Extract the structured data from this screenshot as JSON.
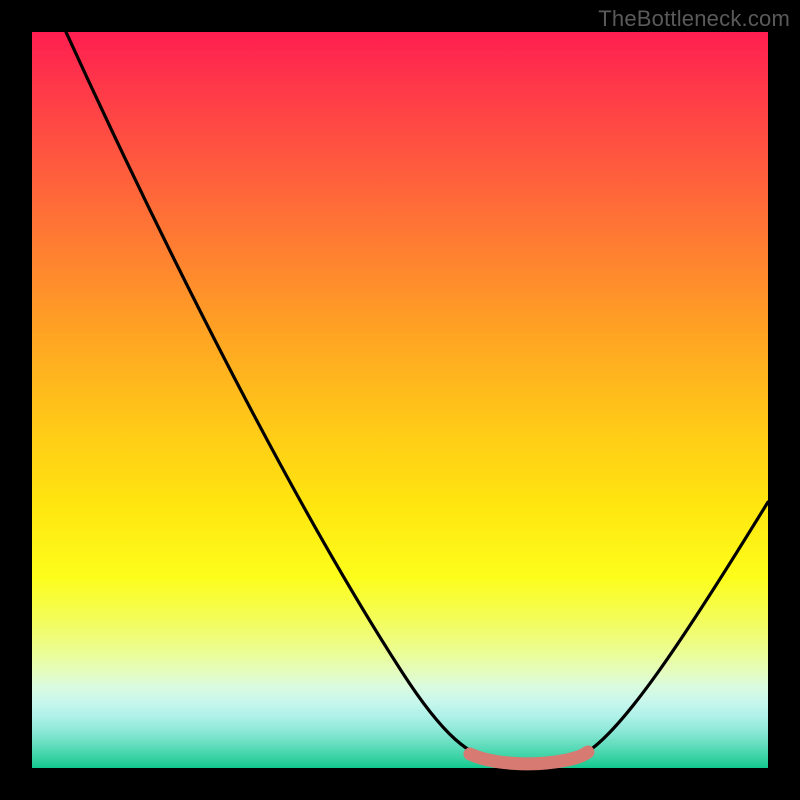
{
  "watermark": "TheBottleneck.com",
  "colors": {
    "black": "#000000",
    "curve": "#000000",
    "trough_highlight": "#d77a72"
  },
  "chart_data": {
    "type": "line",
    "title": "",
    "xlabel": "",
    "ylabel": "",
    "xlim": [
      0,
      100
    ],
    "ylim": [
      0,
      100
    ],
    "x": [
      0,
      5,
      10,
      15,
      20,
      25,
      30,
      35,
      40,
      45,
      50,
      55,
      60,
      62,
      64,
      66,
      68,
      70,
      72,
      74,
      78,
      82,
      86,
      90,
      94,
      98,
      100
    ],
    "values": [
      100,
      91,
      82,
      73,
      64,
      55,
      46,
      37,
      28,
      20,
      13,
      7,
      3,
      1.5,
      0.7,
      0.3,
      0.2,
      0.3,
      0.8,
      2,
      5,
      10,
      16,
      23,
      30,
      37,
      40
    ],
    "trough_range_x": [
      60,
      74
    ],
    "notes": "V-shaped bottleneck curve on rainbow heat gradient. Flat trough near y≈0 between x≈60 and x≈74 is highlighted in salmon. Right branch rises less steeply than the left branch."
  }
}
